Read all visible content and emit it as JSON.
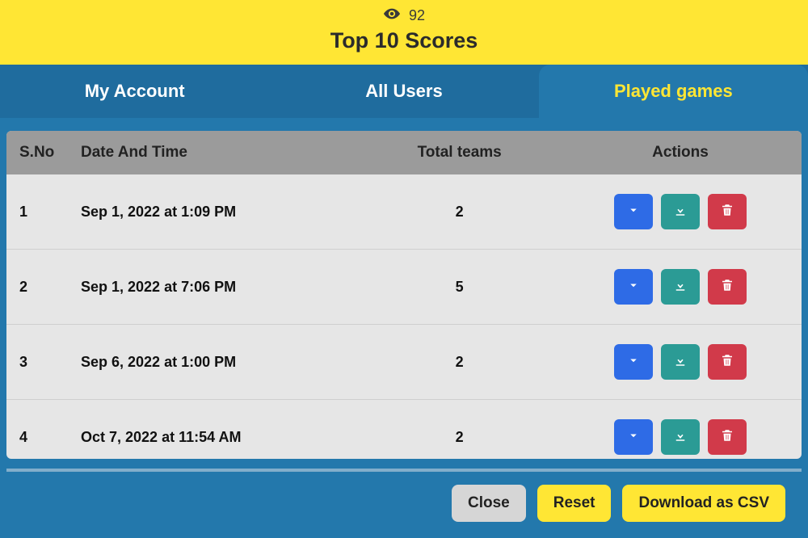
{
  "header": {
    "view_count": "92",
    "title": "Top 10 Scores"
  },
  "tabs": [
    {
      "label": "My Account",
      "active": false
    },
    {
      "label": "All Users",
      "active": false
    },
    {
      "label": "Played games",
      "active": true
    }
  ],
  "table": {
    "headers": {
      "sno": "S.No",
      "date": "Date And Time",
      "teams": "Total teams",
      "actions": "Actions"
    },
    "rows": [
      {
        "sno": "1",
        "date": "Sep 1, 2022 at 1:09 PM",
        "teams": "2"
      },
      {
        "sno": "2",
        "date": "Sep 1, 2022 at 7:06 PM",
        "teams": "5"
      },
      {
        "sno": "3",
        "date": "Sep 6, 2022 at 1:00 PM",
        "teams": "2"
      },
      {
        "sno": "4",
        "date": "Oct 7, 2022 at 11:54 AM",
        "teams": "2"
      }
    ]
  },
  "footer": {
    "close": "Close",
    "reset": "Reset",
    "csv": "Download as CSV"
  },
  "icons": {
    "eye": "eye-icon",
    "chevron_down": "chevron-down-icon",
    "download": "download-icon",
    "trash": "trash-icon"
  },
  "colors": {
    "yellow": "#ffe634",
    "blue_dark": "#1f6c9e",
    "blue": "#2378ac",
    "btn_blue": "#2e6be6",
    "btn_teal": "#2b9b95",
    "btn_red": "#d13a4a"
  }
}
